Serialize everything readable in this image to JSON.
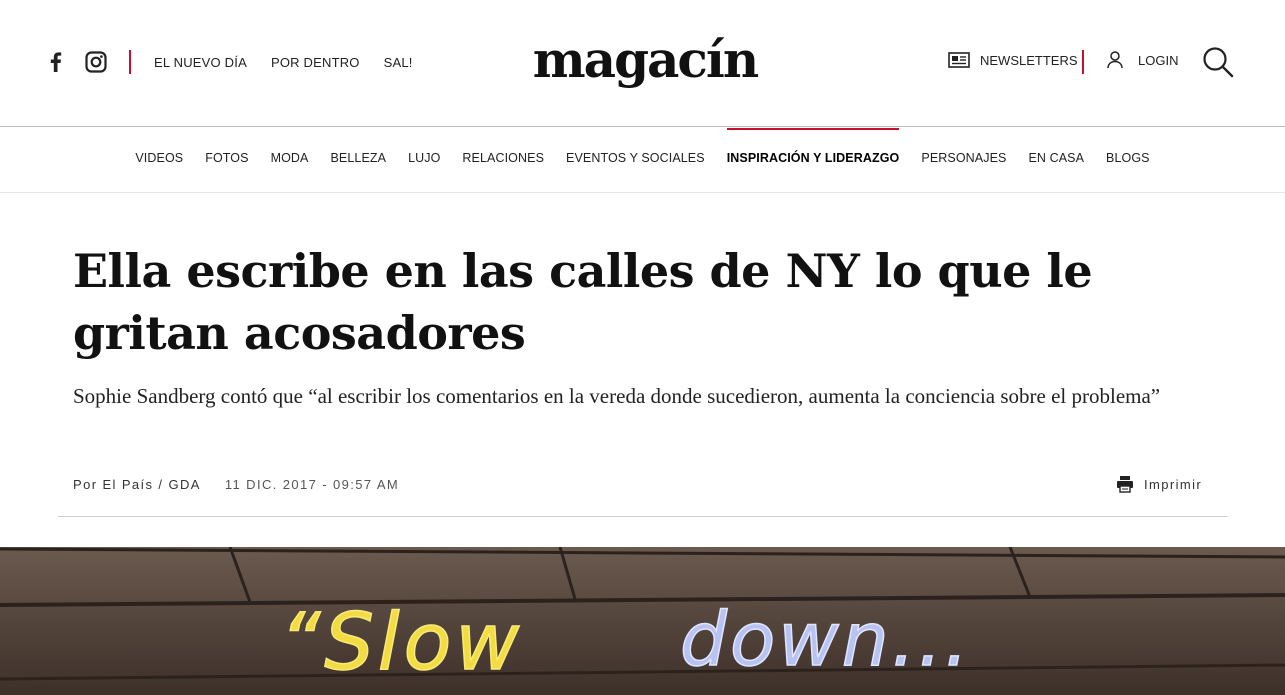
{
  "header": {
    "social": [
      {
        "name": "facebook-icon",
        "glyph": "f"
      },
      {
        "name": "instagram-icon"
      }
    ],
    "top_links": [
      "EL NUEVO DÍA",
      "POR DENTRO",
      "SAL!"
    ],
    "logo": "magacín",
    "newsletters_label": "NEWSLETTERS",
    "login_label": "LOGIN",
    "accent_color": "#c8102e"
  },
  "nav": {
    "items": [
      "VIDEOS",
      "FOTOS",
      "MODA",
      "BELLEZA",
      "LUJO",
      "RELACIONES",
      "EVENTOS Y SOCIALES",
      "INSPIRACIÓN Y LIDERAZGO",
      "PERSONAJES",
      "EN CASA",
      "BLOGS"
    ],
    "active": "INSPIRACIÓN Y LIDERAZGO"
  },
  "article": {
    "title": "Ella escribe en las calles de NY lo que le gritan acosadores",
    "subtitle": "Sophie Sandberg contó que “al escribir los comentarios en la vereda donde sucedieron, aumenta la conciencia sobre el problema”",
    "author": "Por El País / GDA",
    "date": "11 DIC. 2017 - 09:57 AM",
    "print_label": "Imprimir"
  },
  "hero_image": {
    "chalk_text_1": "“Slow",
    "chalk_text_2": "down..."
  }
}
